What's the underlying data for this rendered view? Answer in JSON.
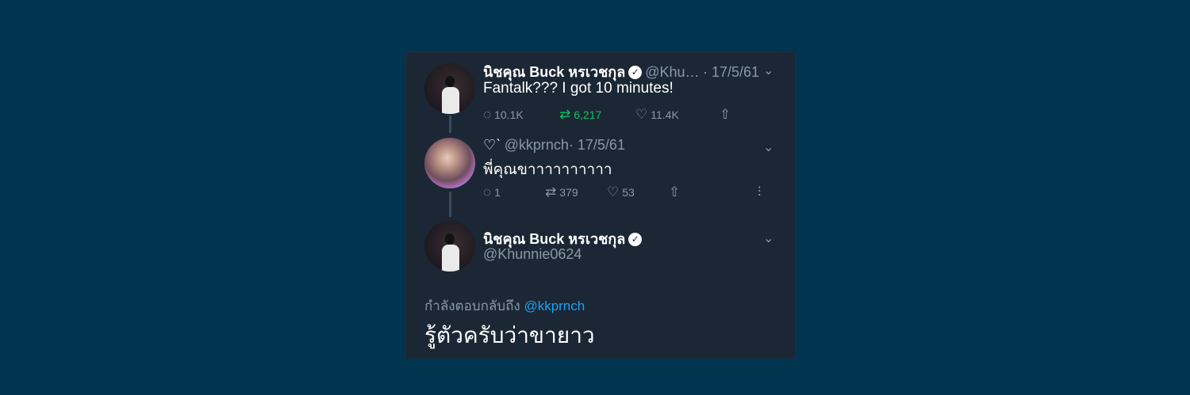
{
  "tweet1": {
    "name": "นิชคุณ Buck หรเวชกุล",
    "handle": "@Khu…",
    "date": "· 17/5/61",
    "text": "Fantalk??? I got 10 minutes!",
    "replies": "10.1K",
    "retweets": "6,217",
    "likes": "11.4K"
  },
  "tweet2": {
    "name": "♡ˋ",
    "handle": "@kkprnch",
    "date": "· 17/5/61",
    "text": "พี่คุณขาาาาาาาาาา",
    "replies": "1",
    "retweets": "379",
    "likes": "53"
  },
  "tweet3": {
    "name": "นิชคุณ Buck หรเวชกุล",
    "handle": "@Khunnie0624",
    "reply_prefix": "กำลังตอบกลับถึง",
    "reply_mention": "@kkprnch",
    "text": "รู้ตัวครับว่าขายาว"
  },
  "icons": {
    "verified": "verified-badge-icon",
    "chevron": "chevron-down-icon",
    "reply": "reply-icon",
    "retweet": "retweet-icon",
    "like": "heart-icon",
    "share": "share-icon",
    "analytics": "analytics-icon"
  },
  "colors": {
    "background": "#00344f",
    "card": "#1b2735",
    "muted": "#8899a6",
    "retweet_active": "#17bf63",
    "mention": "#1da1f2"
  }
}
